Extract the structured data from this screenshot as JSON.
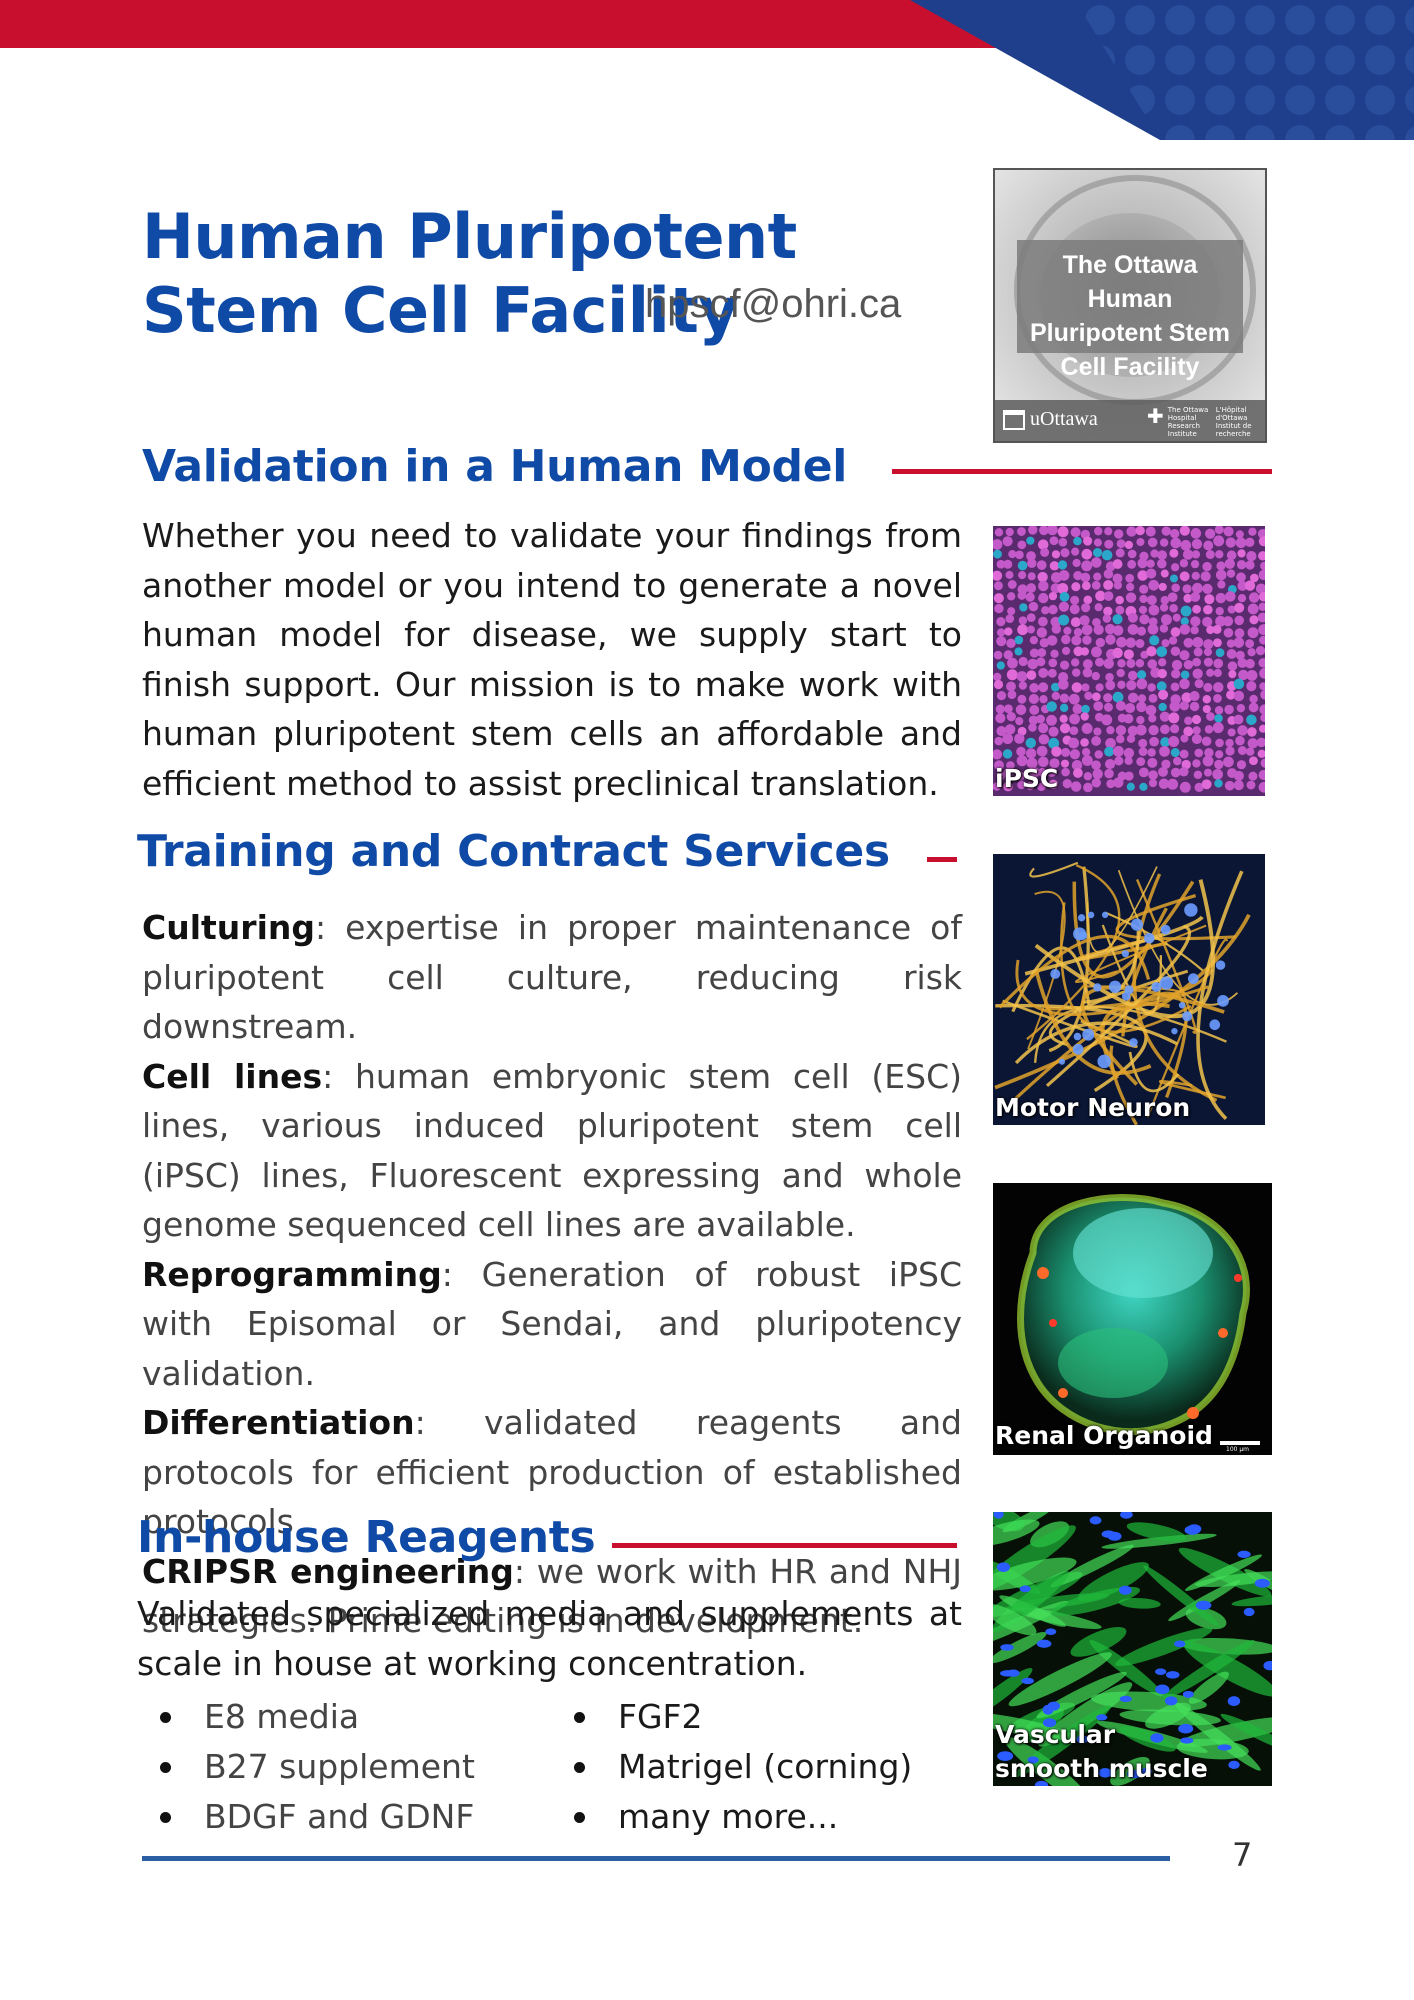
{
  "header": {
    "title": "Human Pluripotent Stem Cell Facility",
    "email": "hpscf@ohri.ca"
  },
  "colors": {
    "brand_blue": "#0f4aa6",
    "accent_red": "#c8102e",
    "navy": "#1f3e8c",
    "footer_blue": "#2a5fa5"
  },
  "logo_image": {
    "text": "The Ottawa Human Pluripotent Stem Cell Facility",
    "uottawa": "uOttawa",
    "hospital_en": "The Ottawa Hospital Research Institute",
    "hospital_fr": "L'Hôpital d'Ottawa Institut de recherche"
  },
  "sections": {
    "validation": {
      "heading": "Validation in a Human Model",
      "body": "Whether you need to validate your findings from another model or you intend to generate a novel human model for disease, we supply start to finish support. Our mission is to make work with human pluripotent stem cells an affordable and efficient method to assist preclinical translation."
    },
    "training": {
      "heading": "Training and Contract Services",
      "services": [
        {
          "term": "Culturing",
          "desc": ": expertise in proper maintenance of pluripotent cell culture, reducing risk downstream."
        },
        {
          "term": "Cell lines",
          "desc": ": human embryonic stem cell (ESC) lines, various induced pluripotent stem cell (iPSC) lines, Fluorescent expressing and whole genome sequenced cell lines are available."
        },
        {
          "term": "Reprogramming",
          "desc": ": Generation of robust iPSC with Episomal or Sendai, and pluripotency validation."
        },
        {
          "term": "Differentiation",
          "desc": ": validated reagents and protocols for  efficient production of established protocols"
        },
        {
          "term": "CRIPSR engineering",
          "desc": ": we work with HR and NHJ strategies. Prime editing is in development."
        }
      ]
    },
    "reagents": {
      "heading": "In-house Reagents",
      "body": "Validated specialized media and supplements at scale in house at working concentration.",
      "list_left": [
        "E8 media",
        "B27 supplement",
        "BDGF and GDNF"
      ],
      "list_right": [
        "FGF2",
        "Matrigel (corning)",
        "many more..."
      ]
    }
  },
  "images": {
    "ipsc": "iPSC",
    "motor_neuron": "Motor Neuron",
    "renal": "Renal Organoid",
    "renal_scale": "100 µm",
    "vascular_1": "Vascular",
    "vascular_2": "smooth muscle"
  },
  "footer": {
    "page_number": "7"
  }
}
